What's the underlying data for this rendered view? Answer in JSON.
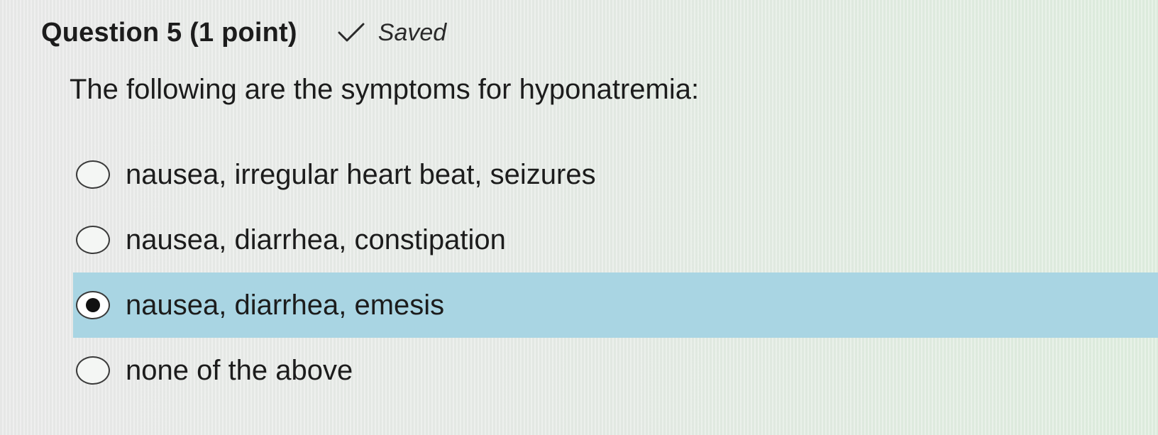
{
  "question": {
    "title": "Question 5 (1 point)",
    "status_icon": "check-icon",
    "status_label": "Saved",
    "prompt": "The following are the symptoms for hyponatremia:"
  },
  "options": [
    {
      "label": "nausea, irregular heart beat, seizures",
      "selected": false
    },
    {
      "label": "nausea, diarrhea, constipation",
      "selected": false
    },
    {
      "label": "nausea, diarrhea, emesis",
      "selected": true
    },
    {
      "label": "none of the above",
      "selected": false
    }
  ],
  "colors": {
    "selected_background": "#a9d5e3",
    "text": "#1c1c1c"
  }
}
